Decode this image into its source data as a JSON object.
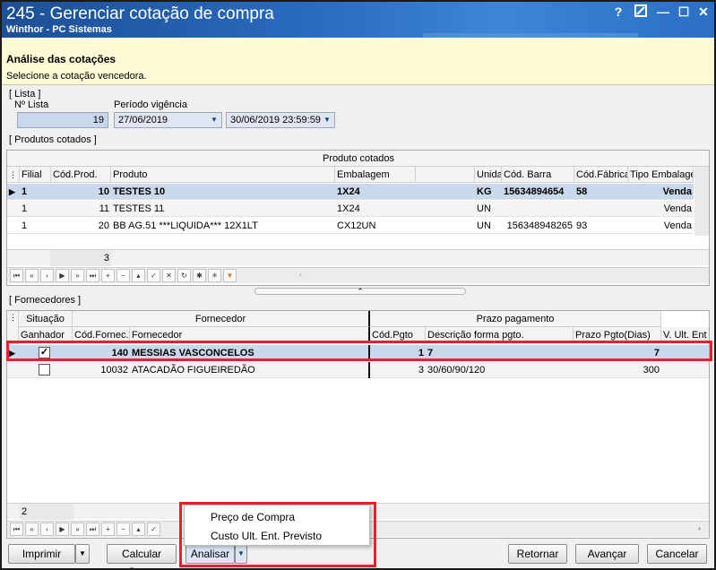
{
  "window": {
    "title": "245 - Gerenciar cotação de compra",
    "subtitle": "Winthor - PC Sistemas",
    "help": "?",
    "minimize": "—",
    "maximize": "☐",
    "close": "✕"
  },
  "header": {
    "title": "Análise das cotações",
    "subtitle": "Selecione a cotação vencedora."
  },
  "lista": {
    "section_label": "[ Lista ]",
    "num_label": "Nº Lista",
    "num_value": "19",
    "period_label": "Período vigência",
    "date_from": "27/06/2019",
    "date_to": "30/06/2019 23:59:59"
  },
  "produtos": {
    "section_label": "[ Produtos cotados ]",
    "group_header": "Produto cotados",
    "columns": [
      "Filial",
      "Cód.Prod.",
      "Produto",
      "Embalagem",
      "",
      "Unida",
      "Cód. Barra",
      "Cód.Fábrica",
      "Tipo Embalage"
    ],
    "rows": [
      {
        "filial": "1",
        "cod": "10",
        "produto": "TESTES 10",
        "emb": "1X24",
        "un": "KG",
        "barra": "15634894654",
        "fab": "58",
        "tipo": "Venda"
      },
      {
        "filial": "1",
        "cod": "11",
        "produto": "TESTES 11",
        "emb": "1X24",
        "un": "UN",
        "barra": "",
        "fab": "",
        "tipo": "Venda"
      },
      {
        "filial": "1",
        "cod": "20",
        "produto": "BB AG.51 ***LIQUIDA*** 12X1LT",
        "emb": "CX12UN",
        "un": "UN",
        "barra": "156348948265",
        "fab": "93",
        "tipo": "Venda"
      }
    ],
    "footer_count": "3"
  },
  "fornecedores": {
    "section_label": "[ Fornecedores ]",
    "group_situacao": "Situação",
    "group_fornecedor": "Fornecedor",
    "group_prazo": "Prazo pagamento",
    "columns": [
      "Ganhador",
      "Cód.Fornec.",
      "Fornecedor",
      "Cód.Pgto",
      "Descrição forma pgto.",
      "Prazo Pgto(Dias)",
      "V. Ult. Ent"
    ],
    "rows": [
      {
        "ganhador": "✓",
        "cod": "140",
        "nome": "MESSIAS VASCONCELOS",
        "codpgto": "1",
        "desc": "7",
        "prazo": "7"
      },
      {
        "ganhador": "",
        "cod": "10032",
        "nome": "ATACADÃO FIGUEIREDÃO",
        "codpgto": "3",
        "desc": "30/60/90/120",
        "prazo": "300"
      }
    ],
    "footer_count": "2"
  },
  "menu": {
    "item1": "Preço de Compra",
    "item2": "Custo Ult. Ent. Previsto"
  },
  "buttons": {
    "imprimir": "Imprimir",
    "calcular": "Calcular Custo",
    "analisar": "Analisar",
    "retornar": "Retornar",
    "avancar": "Avançar",
    "cancelar": "Cancelar"
  },
  "colors": {
    "highlight_red": "#e8202b",
    "title_blue": "#2a6cc0",
    "selected_row": "#c9d8ea"
  }
}
